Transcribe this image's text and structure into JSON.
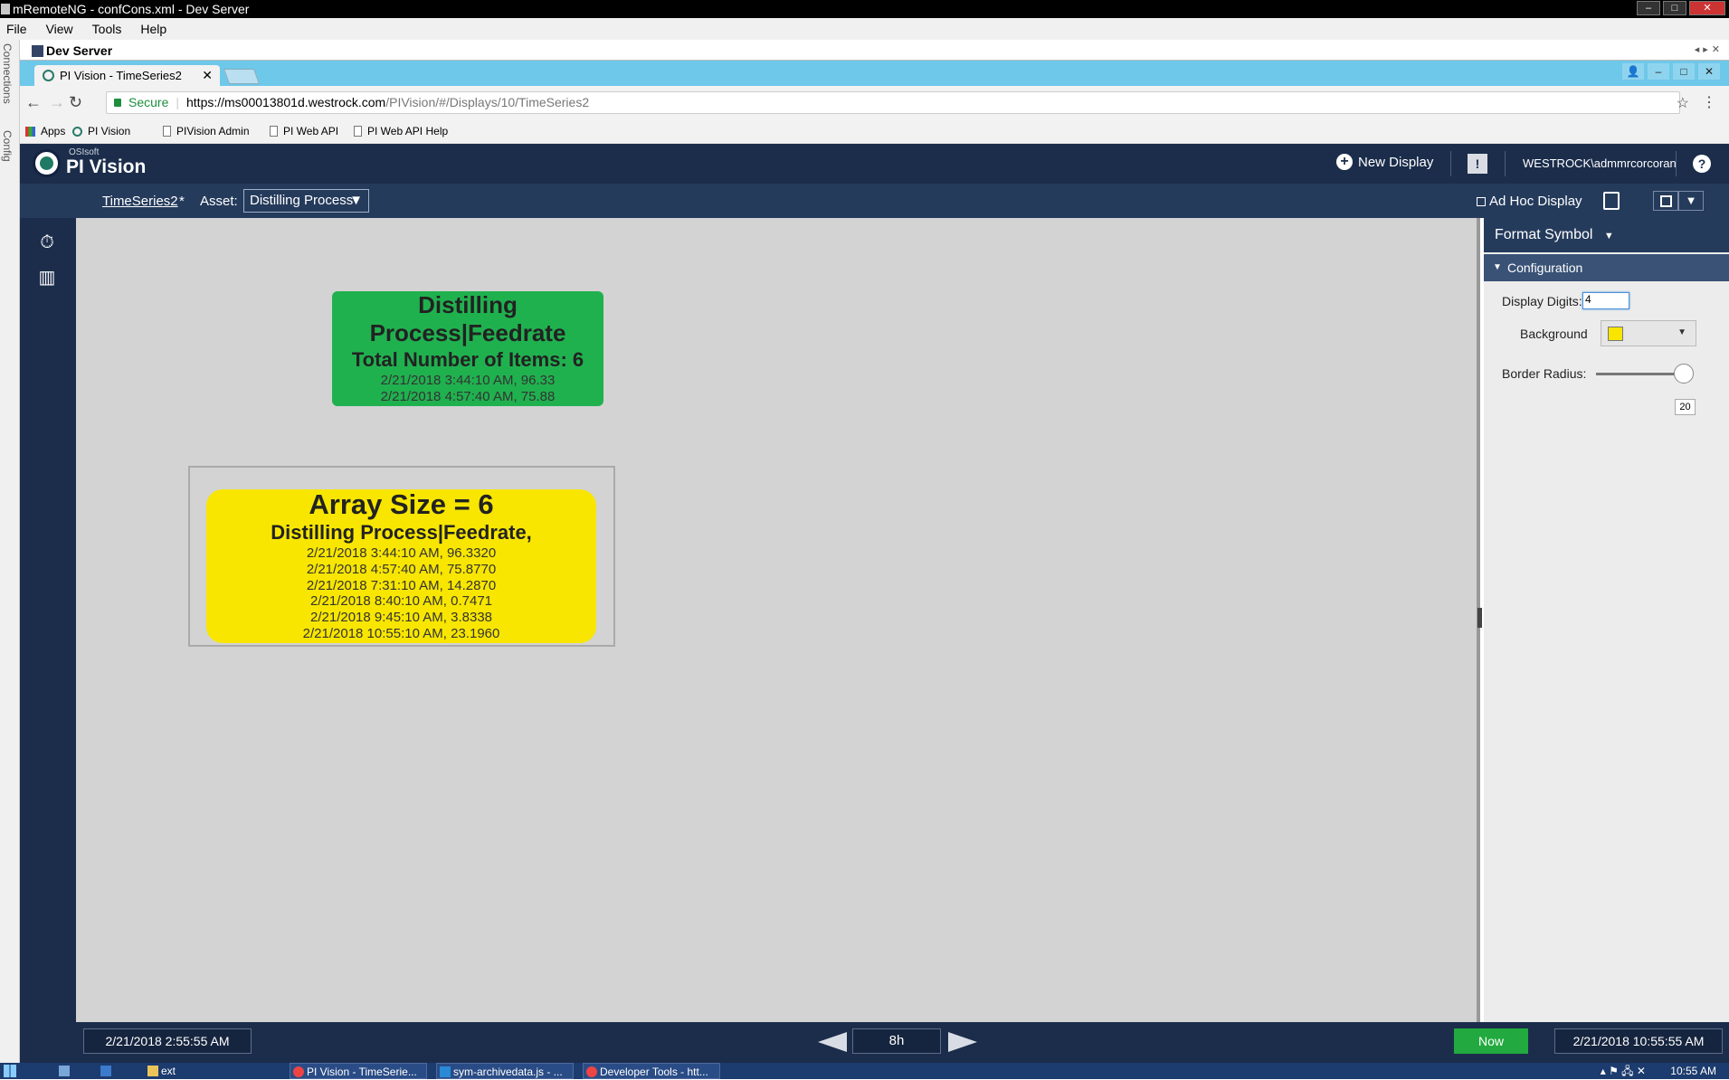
{
  "window": {
    "title": "mRemoteNG - confCons.xml - Dev Server",
    "min": "–",
    "max": "□",
    "close": "✕"
  },
  "menu": [
    "File",
    "View",
    "Tools",
    "Help"
  ],
  "side_strip": [
    "Connections",
    "Config"
  ],
  "connection_tab": "Dev Server",
  "browser": {
    "tab_title": "PI Vision - TimeSeries2",
    "tab_close": "✕",
    "secure_label": "Secure",
    "url_host": "https://ms00013801d.westrock.com",
    "url_path": "/PIVision/#/Displays/10/TimeSeries2",
    "bookmarks": [
      "Apps",
      "PI Vision",
      "PIVision Admin",
      "PI Web API",
      "PI Web API Help"
    ]
  },
  "pivision": {
    "brand_small": "OSIsoft",
    "brand": "PI Vision",
    "new_display": "New Display",
    "alert": "!",
    "user": "WESTROCK\\admmrcorcoran",
    "help": "?",
    "display_name": "TimeSeries2",
    "modified_marker": "*",
    "asset_label": "Asset:",
    "asset_value": "Distilling Process",
    "adhoc_label": "Ad Hoc Display",
    "dropdown_arrow": "▼"
  },
  "green_symbol": {
    "line1": "Distilling",
    "line2": "Process|Feedrate",
    "line3": "Total Number of Items: 6",
    "rows": [
      "2/21/2018 3:44:10 AM,   96.33",
      "2/21/2018 4:57:40 AM,   75.88"
    ],
    "color": "#20b14f"
  },
  "yellow_symbol": {
    "line1": "Array Size = 6",
    "line2": "Distilling Process|Feedrate,",
    "rows": [
      "2/21/2018 3:44:10 AM,   96.3320",
      "2/21/2018 4:57:40 AM,   75.8770",
      "2/21/2018 7:31:10 AM,   14.2870",
      "2/21/2018 8:40:10 AM,   0.7471",
      "2/21/2018 9:45:10 AM,   3.8338",
      "2/21/2018 10:55:10 AM,   23.1960"
    ],
    "color": "#f8e600"
  },
  "zoom": {
    "in": "+",
    "out": "−",
    "fit": "⛶"
  },
  "format_panel": {
    "title": "Format Symbol",
    "section": "Configuration",
    "display_digits_label": "Display Digits:",
    "display_digits_value": "4",
    "background_label": "Background",
    "background_color": "#f8e600",
    "border_radius_label": "Border Radius:",
    "border_radius_value": "20"
  },
  "timebar": {
    "start": "2/21/2018 2:55:55 AM",
    "duration": "8h",
    "now": "Now",
    "end": "2/21/2018 10:55:55 AM"
  },
  "taskbar": {
    "items": [
      "ext",
      "PI Vision - TimeSerie...",
      "sym-archivedata.js - ...",
      "Developer Tools - htt..."
    ],
    "clock": "10:55 AM"
  }
}
